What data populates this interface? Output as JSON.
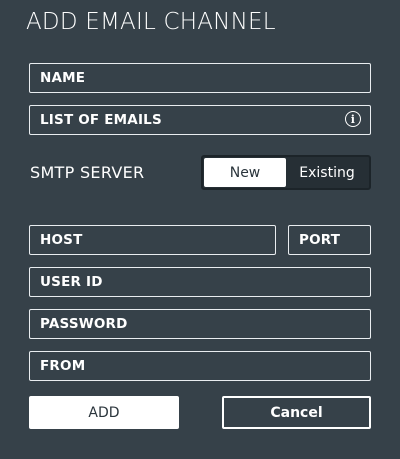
{
  "dialog": {
    "title": "ADD EMAIL CHANNEL"
  },
  "fields": {
    "name": "NAME",
    "list_of_emails": "LIST OF EMAILS",
    "host": "HOST",
    "port": "PORT",
    "user_id": "USER ID",
    "password": "PASSWORD",
    "from": "FROM"
  },
  "smtp": {
    "label": "SMTP SERVER",
    "options": [
      "New",
      "Existing"
    ],
    "selected": "New"
  },
  "buttons": {
    "add": "ADD",
    "cancel": "Cancel"
  },
  "icons": {
    "info": "info-icon"
  }
}
